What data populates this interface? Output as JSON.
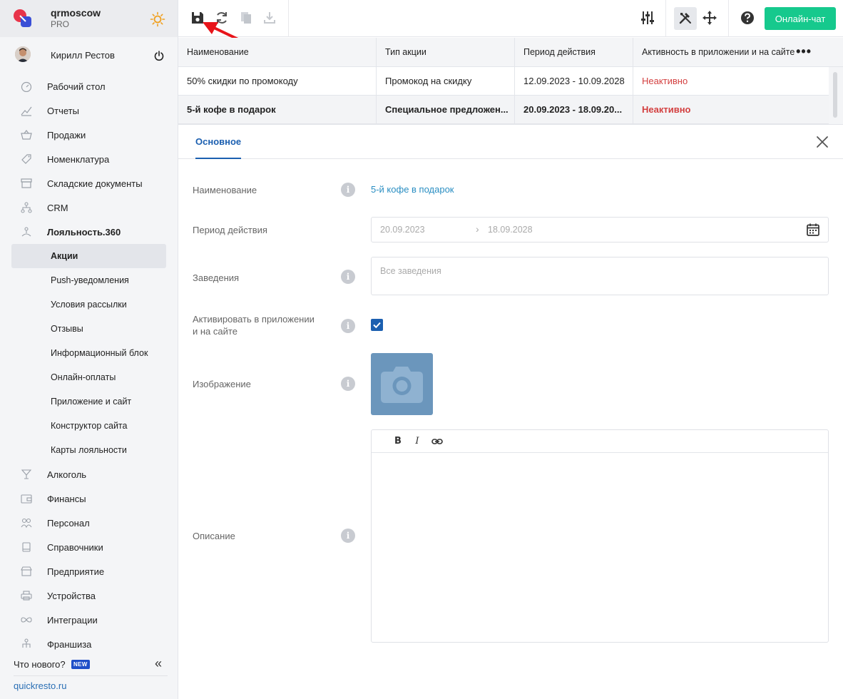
{
  "org": {
    "name": "qrmoscow",
    "plan": "PRO"
  },
  "user": {
    "name": "Кирилл Рестов"
  },
  "menu": [
    {
      "label": "Рабочий стол",
      "icon": "dashboard-icon"
    },
    {
      "label": "Отчеты",
      "icon": "chart-icon"
    },
    {
      "label": "Продажи",
      "icon": "basket-icon"
    },
    {
      "label": "Номенклатура",
      "icon": "tag-icon"
    },
    {
      "label": "Складские документы",
      "icon": "archive-icon"
    },
    {
      "label": "CRM",
      "icon": "hierarchy-icon"
    },
    {
      "label": "Лояльность.360",
      "icon": "loyalty-icon"
    }
  ],
  "submenu": [
    "Акции",
    "Push-уведомления",
    "Условия рассылки",
    "Отзывы",
    "Информационный блок",
    "Онлайн-оплаты",
    "Приложение и сайт",
    "Конструктор сайта",
    "Карты лояльности"
  ],
  "menu_bottom": [
    {
      "label": "Алкоголь",
      "icon": "cocktail-icon"
    },
    {
      "label": "Финансы",
      "icon": "wallet-icon"
    },
    {
      "label": "Персонал",
      "icon": "people-icon"
    },
    {
      "label": "Справочники",
      "icon": "book-icon"
    },
    {
      "label": "Предприятие",
      "icon": "store-icon"
    },
    {
      "label": "Устройства",
      "icon": "printer-icon"
    },
    {
      "label": "Интеграции",
      "icon": "infinity-icon"
    },
    {
      "label": "Франшиза",
      "icon": "franchise-icon"
    }
  ],
  "whats_new": {
    "label": "Что нового?",
    "badge": "NEW"
  },
  "site_link": "quickresto.ru",
  "toolbar": {
    "chat_label": "Онлайн-чат"
  },
  "table": {
    "headers": [
      "Наименование",
      "Тип акции",
      "Период действия",
      "Активность в приложении и на сайте"
    ],
    "rows": [
      [
        "50% скидки по промокоду",
        "Промокод на скидку",
        "12.09.2023 - 10.09.2028",
        "Неактивно"
      ],
      [
        "5-й кофе в подарок",
        "Специальное предложен...",
        "20.09.2023 - 18.09.20...",
        "Неактивно"
      ]
    ]
  },
  "panel": {
    "tab": "Основное",
    "labels": {
      "name": "Наименование",
      "period": "Период действия",
      "venues": "Заведения",
      "activate": "Активировать в приложении и на сайте",
      "image": "Изображение",
      "description": "Описание"
    },
    "name_value": "5-й кофе в подарок",
    "period_from": "20.09.2023",
    "period_to": "18.09.2028",
    "venues_placeholder": "Все заведения",
    "activate_checked": true,
    "editor_buttons": [
      "B",
      "I"
    ]
  },
  "colors": {
    "accent": "#1b5fb0",
    "chat": "#16c98d",
    "inactive": "#d33f3f",
    "link": "#2a8ec2"
  }
}
